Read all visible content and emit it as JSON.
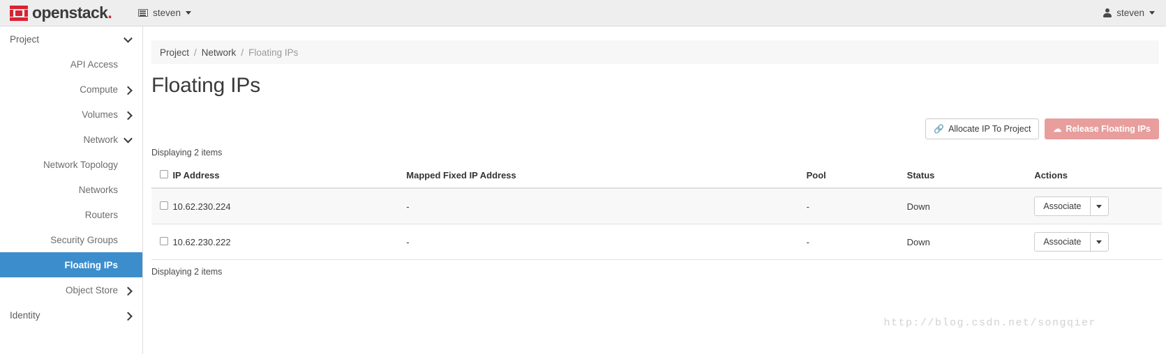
{
  "navbar": {
    "brand": "openstack",
    "brand_dot": ".",
    "project_label": "steven",
    "user_label": "steven",
    "icons": {
      "project": "project-window-icon",
      "user": "user-icon",
      "caret": "caret-down-icon"
    }
  },
  "sidebar": {
    "items": [
      {
        "label": "Project",
        "depth": 0,
        "chev": "down",
        "active": false
      },
      {
        "label": "API Access",
        "depth": 1,
        "chev": "none",
        "active": false
      },
      {
        "label": "Compute",
        "depth": 1,
        "chev": "right",
        "active": false
      },
      {
        "label": "Volumes",
        "depth": 1,
        "chev": "right",
        "active": false
      },
      {
        "label": "Network",
        "depth": 1,
        "chev": "down",
        "active": false
      },
      {
        "label": "Network Topology",
        "depth": 2,
        "chev": "none",
        "active": false
      },
      {
        "label": "Networks",
        "depth": 2,
        "chev": "none",
        "active": false
      },
      {
        "label": "Routers",
        "depth": 2,
        "chev": "none",
        "active": false
      },
      {
        "label": "Security Groups",
        "depth": 2,
        "chev": "none",
        "active": false
      },
      {
        "label": "Floating IPs",
        "depth": 2,
        "chev": "none",
        "active": true
      },
      {
        "label": "Object Store",
        "depth": 1,
        "chev": "right",
        "active": false
      },
      {
        "label": "Identity",
        "depth": 0,
        "chev": "right",
        "active": false
      }
    ],
    "active_bg": "#3c8dcc"
  },
  "breadcrumb": {
    "items": [
      "Project",
      "Network",
      "Floating IPs"
    ],
    "separator": "/"
  },
  "page": {
    "title": "Floating IPs",
    "count_top": "Displaying 2 items",
    "count_bottom": "Displaying 2 items"
  },
  "toolbar": {
    "allocate_label": "Allocate IP To Project",
    "allocate_icon": "chain-link-icon",
    "release_label": "Release Floating IPs",
    "release_icon": "broken-chain-icon",
    "release_color": "#e79e9c"
  },
  "table": {
    "headers": [
      "IP Address",
      "Mapped Fixed IP Address",
      "Pool",
      "Status",
      "Actions"
    ],
    "rows": [
      {
        "ip": "10.62.230.224",
        "mapped": "-",
        "pool": "-",
        "status": "Down",
        "action_label": "Associate"
      },
      {
        "ip": "10.62.230.222",
        "mapped": "-",
        "pool": "-",
        "status": "Down",
        "action_label": "Associate"
      }
    ]
  },
  "watermark": "http://blog.csdn.net/songqier"
}
